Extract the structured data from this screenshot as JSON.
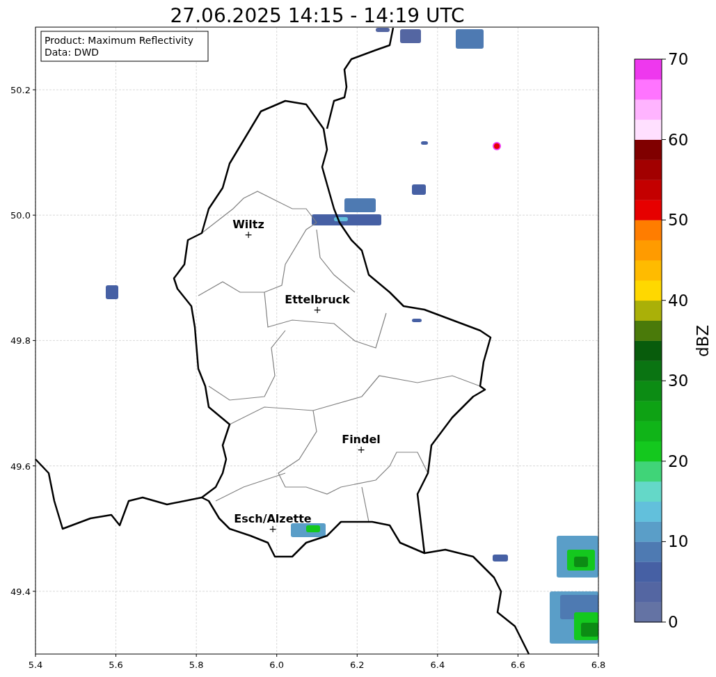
{
  "title": "27.06.2025 14:15 - 14:19 UTC",
  "info_box": [
    "Product: Maximum Reflectivity",
    "Data: DWD"
  ],
  "map": {
    "x_ticks": [
      "5.4",
      "5.6",
      "5.8",
      "6.0",
      "6.2",
      "6.4",
      "6.6",
      "6.8"
    ],
    "y_ticks": [
      "50.2",
      "50.0",
      "49.8",
      "49.6",
      "49.4"
    ],
    "cities": [
      {
        "name": "Wiltz",
        "marker": "+"
      },
      {
        "name": "Ettelbruck",
        "marker": "+"
      },
      {
        "name": "Findel",
        "marker": "+"
      },
      {
        "name": "Esch/Alzette",
        "marker": "+"
      }
    ]
  },
  "colorbar": {
    "label": "dBZ",
    "ticks": [
      "70",
      "60",
      "50",
      "40",
      "30",
      "20",
      "10",
      "0"
    ],
    "bands": [
      {
        "color": "#6473a4"
      },
      {
        "color": "#5466a2"
      },
      {
        "color": "#4660a4"
      },
      {
        "color": "#4e7ab2"
      },
      {
        "color": "#5a9ec8"
      },
      {
        "color": "#62c0dc"
      },
      {
        "color": "#64d8c8"
      },
      {
        "color": "#40d478"
      },
      {
        "color": "#14c81e"
      },
      {
        "color": "#10b418"
      },
      {
        "color": "#0ea214"
      },
      {
        "color": "#0c8c14"
      },
      {
        "color": "#0a7412"
      },
      {
        "color": "#085c0c"
      },
      {
        "color": "#4a7a0a"
      },
      {
        "color": "#aab008"
      },
      {
        "color": "#ffd800"
      },
      {
        "color": "#ffbb00"
      },
      {
        "color": "#ff9b00"
      },
      {
        "color": "#ff7d00"
      },
      {
        "color": "#e60000"
      },
      {
        "color": "#c40000"
      },
      {
        "color": "#a20000"
      },
      {
        "color": "#800000"
      },
      {
        "color": "#ffe0ff"
      },
      {
        "color": "#ffb4ff"
      },
      {
        "color": "#ff74ff"
      },
      {
        "color": "#ee38ee"
      }
    ]
  }
}
